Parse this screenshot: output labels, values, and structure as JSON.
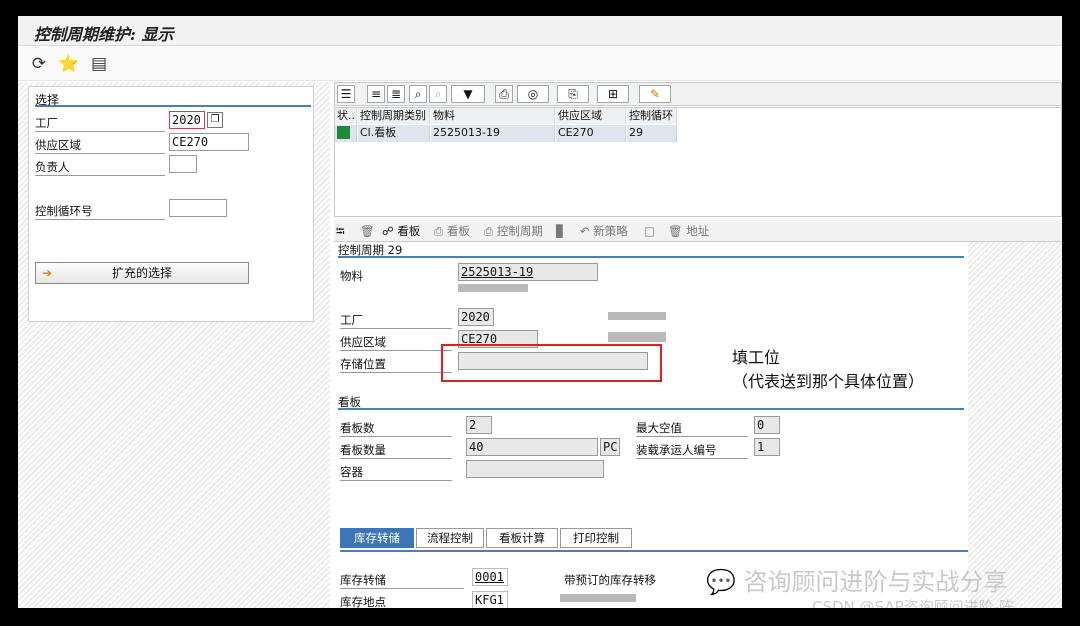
{
  "window": {
    "title": "控制周期维护: 显示"
  },
  "toolbar": {
    "icons": [
      "execute-icon",
      "glasses-icon",
      "layout-icon"
    ]
  },
  "selection": {
    "group_title": "选择",
    "plant_label": "工厂",
    "plant_value": "2020",
    "supply_area_label": "供应区域",
    "supply_area_value": "CE270",
    "responsible_label": "负责人",
    "responsible_value": "",
    "cycle_no_label": "控制循环号",
    "cycle_no_value": "",
    "extended_button": "扩充的选择"
  },
  "grid": {
    "columns": [
      "状...",
      "控制周期类别",
      "物料",
      "供应区域",
      "控制循环"
    ],
    "rows": [
      {
        "category": "Cl.看板",
        "material": "2525013-19",
        "area": "CE270",
        "cycle": "29"
      }
    ]
  },
  "detail_toolbar": {
    "kanban": "看板",
    "kanban2": "看板",
    "control_cycle": "控制周期",
    "new_strategy": "新策略",
    "address": "地址"
  },
  "control_cycle": {
    "title": "控制周期 29",
    "material_label": "物料",
    "material_value": "2525013-19",
    "plant_label": "工厂",
    "plant_value": "2020",
    "supply_area_label": "供应区域",
    "supply_area_value": "CE270",
    "storage_label": "存储位置",
    "storage_value": ""
  },
  "annotation": {
    "line1": "填工位",
    "line2": "（代表送到那个具体位置）"
  },
  "kanban": {
    "title": "看板",
    "count_label": "看板数",
    "count_value": "2",
    "max_empty_label": "最大空值",
    "max_empty_value": "0",
    "qty_label": "看板数量",
    "qty_value": "40",
    "qty_unit": "PC",
    "carrier_label": "装载承运人编号",
    "carrier_value": "1",
    "container_label": "容器",
    "container_value": ""
  },
  "tabs": [
    "库存转储",
    "流程控制",
    "看板计算",
    "打印控制"
  ],
  "transfer": {
    "transfer_label": "库存转储",
    "transfer_value": "0001",
    "reserved_label": "带预订的库存转移",
    "sloc_label": "库存地点",
    "sloc_value": "KFG1"
  },
  "watermark": {
    "line1": "咨询顾问进阶与实战分享",
    "line2": "CSDN @SAP咨询顾问进阶-陈"
  },
  "colors": {
    "accent": "#4a7eb5",
    "tab_active": "#3d76b8",
    "annotation_border": "#e02020",
    "status_green": "#1d8a3a"
  }
}
